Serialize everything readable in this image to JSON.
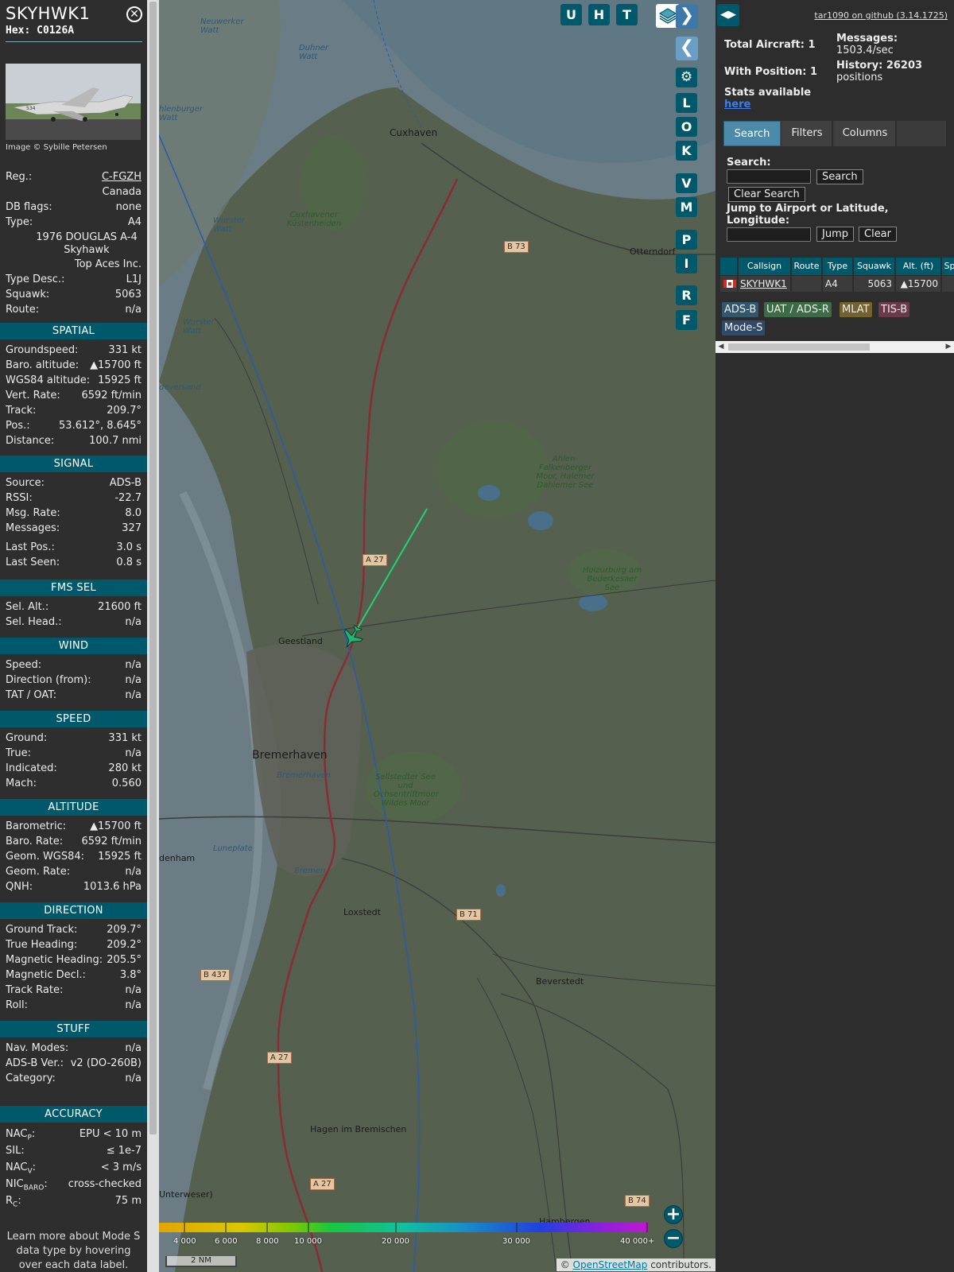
{
  "aircraft": {
    "callsign": "SKYHWK1",
    "hex_label": "Hex:",
    "hex": "C0126A",
    "photo_credit": "Image © Sybille Petersen",
    "reg_label": "Reg.:",
    "reg": "C-FGZH",
    "country": "Canada",
    "db_flags_label": "DB flags:",
    "db_flags": "none",
    "type_label": "Type:",
    "type": "A4",
    "model": "1976 DOUGLAS A-4 Skyhawk",
    "operator": "Top Aces Inc.",
    "type_desc_label": "Type Desc.:",
    "type_desc": "L1J",
    "squawk_label": "Squawk:",
    "squawk": "5063",
    "route_label": "Route:",
    "route": "n/a"
  },
  "sections": {
    "spatial": {
      "title": "SPATIAL",
      "rows": [
        {
          "k": "Groundspeed:",
          "v": "331 kt"
        },
        {
          "k": "Baro. altitude:",
          "v": "▲15700 ft"
        },
        {
          "k": "WGS84 altitude:",
          "v": "15925 ft"
        },
        {
          "k": "Vert. Rate:",
          "v": "6592 ft/min"
        },
        {
          "k": "Track:",
          "v": "209.7°"
        },
        {
          "k": "Pos.:",
          "v": "53.612°, 8.645°"
        },
        {
          "k": "Distance:",
          "v": "100.7 nmi"
        }
      ]
    },
    "signal": {
      "title": "SIGNAL",
      "rows": [
        {
          "k": "Source:",
          "v": "ADS-B"
        },
        {
          "k": "RSSI:",
          "v": "-22.7"
        },
        {
          "k": "Msg. Rate:",
          "v": "8.0"
        },
        {
          "k": "Messages:",
          "v": "327"
        },
        {
          "k": "Last Pos.:",
          "v": "3.0 s"
        },
        {
          "k": "Last Seen:",
          "v": "0.8 s"
        }
      ]
    },
    "fms": {
      "title": "FMS SEL",
      "rows": [
        {
          "k": "Sel. Alt.:",
          "v": "21600 ft"
        },
        {
          "k": "Sel. Head.:",
          "v": "n/a"
        }
      ]
    },
    "wind": {
      "title": "WIND",
      "rows": [
        {
          "k": "Speed:",
          "v": "n/a"
        },
        {
          "k": "Direction (from):",
          "v": "n/a"
        },
        {
          "k": "TAT / OAT:",
          "v": "n/a"
        }
      ]
    },
    "speed": {
      "title": "SPEED",
      "rows": [
        {
          "k": "Ground:",
          "v": "331 kt"
        },
        {
          "k": "True:",
          "v": "n/a"
        },
        {
          "k": "Indicated:",
          "v": "280 kt"
        },
        {
          "k": "Mach:",
          "v": "0.560"
        }
      ]
    },
    "altitude": {
      "title": "ALTITUDE",
      "rows": [
        {
          "k": "Barometric:",
          "v": "▲15700 ft"
        },
        {
          "k": "Baro. Rate:",
          "v": "6592 ft/min"
        },
        {
          "k": "Geom. WGS84:",
          "v": "15925 ft"
        },
        {
          "k": "Geom. Rate:",
          "v": "n/a"
        },
        {
          "k": "QNH:",
          "v": "1013.6 hPa"
        }
      ]
    },
    "direction": {
      "title": "DIRECTION",
      "rows": [
        {
          "k": "Ground Track:",
          "v": "209.7°"
        },
        {
          "k": "True Heading:",
          "v": "209.2°"
        },
        {
          "k": "Magnetic Heading:",
          "v": "205.5°"
        },
        {
          "k": "Magnetic Decl.:",
          "v": "3.8°"
        },
        {
          "k": "Track Rate:",
          "v": "n/a"
        },
        {
          "k": "Roll:",
          "v": "n/a"
        }
      ]
    },
    "stuff": {
      "title": "STUFF",
      "rows": [
        {
          "k": "Nav. Modes:",
          "v": "n/a"
        },
        {
          "k": "ADS-B Ver.:",
          "v": "v2 (DO-260B)"
        },
        {
          "k": "Category:",
          "v": "n/a"
        }
      ]
    },
    "accuracy": {
      "title": "ACCURACY",
      "rows": [
        {
          "k": "NACP:",
          "v": "EPU < 10 m"
        },
        {
          "k": "SIL:",
          "v": "≤ 1e-7"
        },
        {
          "k": "NACV:",
          "v": "< 3 m/s"
        },
        {
          "k": "NICBARO:",
          "v": "cross-checked"
        },
        {
          "k": "RC:",
          "v": "75 m"
        }
      ]
    }
  },
  "info_footer": "Learn more about Mode S data type by hovering over each data label.",
  "map": {
    "top_buttons": [
      "U",
      "H",
      "T"
    ],
    "side_buttons": [
      "L",
      "O",
      "K",
      "V",
      "M",
      "P",
      "I",
      "R",
      "F"
    ],
    "labels": {
      "cuxhaven": "Cuxhaven",
      "otterndorf": "Otterndorf",
      "geestland": "Geestland",
      "bremerhaven": "Bremerhaven",
      "bremerhaven_small": "Bremerhaven",
      "loxstedt": "Loxstedt",
      "beverstedt": "Beverstedt",
      "hagen": "Hagen im Bremischen",
      "hambergen": "Hambergen",
      "denham": "denham",
      "unterweser": "Unterweser)",
      "neuwerker_watt": "Neuwerker Watt",
      "duhner_watt": "Duhner Watt",
      "hlenburger_watt": "hlenburger Watt",
      "wurster_watt": "Wurster Watt",
      "wurster_watt2": "Wurster Watt",
      "deversand": "deversand",
      "luneplate": "Luneplate",
      "bremen_river": "Bremen",
      "cuxhavener": "Cuxhavener Küstenheiden",
      "ahlen": "Ahlen-Falkenberger Moor, Halemer Dahlemer See",
      "holzurburg": "Holzurburg am Bederkesaer See",
      "sellstedter": "Sellstedter See und Ochsentriftmoor Wildes Moor",
      "shields": [
        "B 73",
        "A 27",
        "B 71",
        "B 437",
        "A 27",
        "A 27",
        "B 74"
      ]
    },
    "color_bar_labels": [
      "4 000",
      "6 000",
      "8 000",
      "10 000",
      "20 000",
      "30 000",
      "40 000+"
    ],
    "scale": "2 NM",
    "attribution_prefix": "© ",
    "attribution_link": "OpenStreetMap",
    "attribution_suffix": " contributors."
  },
  "right": {
    "version_link": "tar1090 on github (3.14.1725)",
    "total_aircraft": "Total Aircraft: 1",
    "with_position": "With Position: 1",
    "stats_available": "Stats available",
    "here": "here",
    "messages_label": "Messages:",
    "messages_value": "1503.4/sec",
    "history_label": "History: 26203",
    "history_value": "positions",
    "tabs": [
      "Search",
      "Filters",
      "Columns"
    ],
    "search_label": "Search:",
    "search_button": "Search",
    "clear_search_button": "Clear Search",
    "jump_label": "Jump to Airport or Latitude, Longitude:",
    "jump_button": "Jump",
    "clear_button": "Clear",
    "table_headers": [
      "Callsign",
      "Route",
      "Type",
      "Squawk",
      "Alt. (ft)",
      "Sp"
    ],
    "row": {
      "callsign": "SKYHWK1",
      "route": "",
      "type": "A4",
      "squawk": "5063",
      "alt": "▲15700"
    },
    "legend": [
      "ADS-B",
      "UAT / ADS-R",
      "MLAT",
      "TIS-B",
      "Mode-S"
    ]
  },
  "colors": {
    "accent": "#00596b",
    "track": "#22d17a",
    "adsb": "#32566b",
    "uat": "#3c6b45",
    "mlat": "#73612f",
    "tisb": "#6b3a4a",
    "modes": "#2f4a6b"
  }
}
